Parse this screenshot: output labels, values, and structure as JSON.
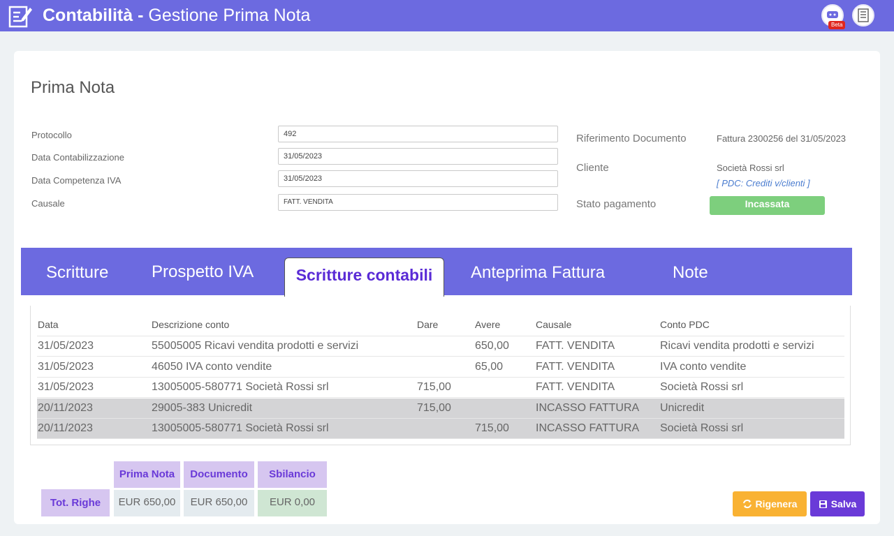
{
  "header": {
    "title_bold": "Contabilità -",
    "title_rest": " Gestione Prima Nota",
    "icons": [
      "edit-document-icon",
      "chat-icon",
      "building-icon"
    ],
    "beta_label": "Beta"
  },
  "page": {
    "title": "Prima Nota"
  },
  "form": {
    "protocollo": {
      "label": "Protocollo",
      "value": "492"
    },
    "data_contabilizzazione": {
      "label": "Data Contabilizzazione",
      "value": "31/05/2023"
    },
    "data_competenza_iva": {
      "label": "Data Competenza IVA",
      "value": "31/05/2023"
    },
    "causale": {
      "label": "Causale",
      "value": "FATT. VENDITA"
    }
  },
  "info": {
    "riferimento_label": "Riferimento Documento",
    "riferimento_value": "Fattura 2300256 del 31/05/2023",
    "cliente_label": "Cliente",
    "cliente_value": "Società Rossi srl",
    "cliente_pdc": "[ PDC: Crediti v/clienti ]",
    "stato_label": "Stato pagamento",
    "stato_value": "Incassata"
  },
  "tabs": [
    {
      "label": "Scritture"
    },
    {
      "label": "Prospetto IVA"
    },
    {
      "label": "Scritture contabili",
      "active": true
    },
    {
      "label": "Anteprima Fattura"
    },
    {
      "label": "Note"
    }
  ],
  "table": {
    "headers": [
      "Data",
      "Descrizione conto",
      "Dare",
      "Avere",
      "Causale",
      "Conto PDC"
    ],
    "rows": [
      [
        "31/05/2023",
        "55005005 Ricavi vendita prodotti e servizi",
        "",
        "650,00",
        "FATT. VENDITA",
        "Ricavi vendita prodotti e servizi"
      ],
      [
        "31/05/2023",
        "46050 IVA conto vendite",
        "",
        "65,00",
        "FATT. VENDITA",
        "IVA conto vendite"
      ],
      [
        "31/05/2023",
        "13005005-580771 Società Rossi srl",
        "715,00",
        "",
        "FATT. VENDITA",
        "Società Rossi srl"
      ],
      [
        "20/11/2023",
        "29005-383 Unicredit",
        "715,00",
        "",
        "INCASSO FATTURA",
        "Unicredit"
      ],
      [
        "20/11/2023",
        "13005005-580771 Società Rossi srl",
        "",
        "715,00",
        "INCASSO FATTURA",
        "Società Rossi srl"
      ]
    ]
  },
  "totals": {
    "row_label": "Tot. Righe",
    "headers": [
      "Prima Nota",
      "Documento",
      "Sbilancio"
    ],
    "values": [
      "EUR 650,00",
      "EUR 650,00",
      "EUR 0,00"
    ]
  },
  "buttons": {
    "rigenera": "Rigenera",
    "salva": "Salva"
  },
  "colors": {
    "primary": "#6c6ae0",
    "accent_purple": "#5a2bd6",
    "success": "#7dcf7d",
    "warning": "#f9b233",
    "save": "#6a3ad8"
  }
}
